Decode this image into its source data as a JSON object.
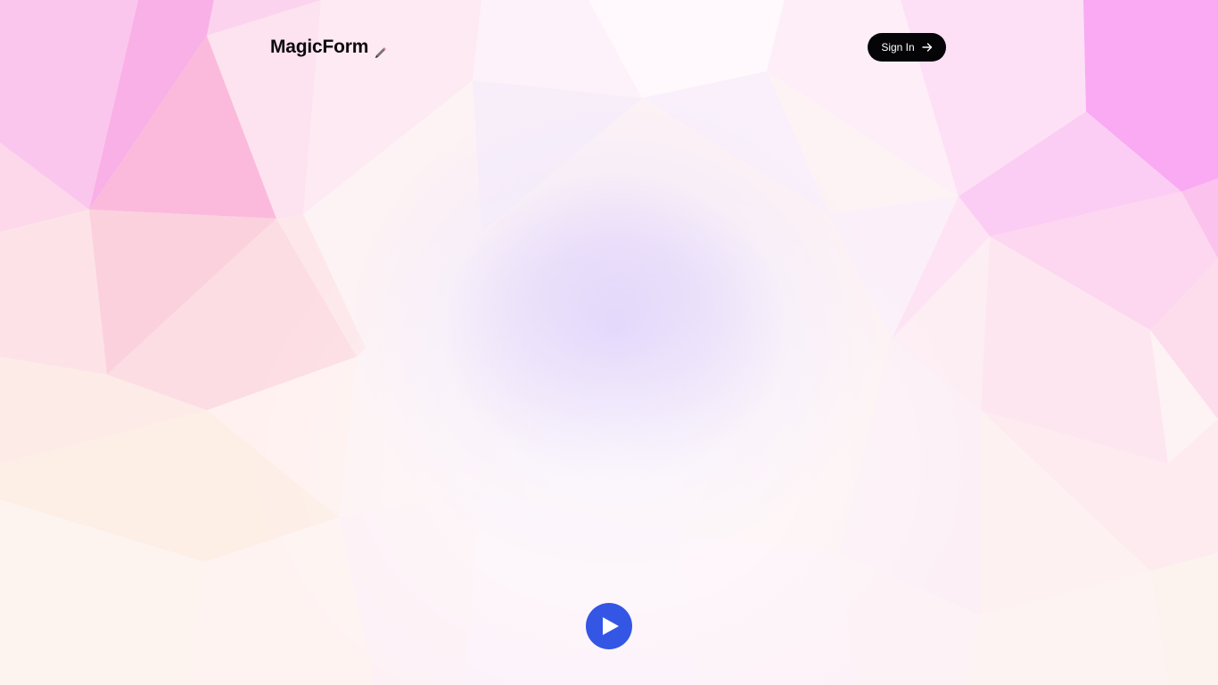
{
  "header": {
    "brand_name": "MagicForm",
    "brand_icon": "pencil-icon",
    "sign_in_label": "Sign In",
    "sign_in_icon": "arrow-right-icon"
  },
  "hero": {
    "play_icon": "play-icon"
  },
  "colors": {
    "accent": "#3456e4",
    "button_dark": "#050507",
    "text_dark": "#0b0b0f"
  }
}
